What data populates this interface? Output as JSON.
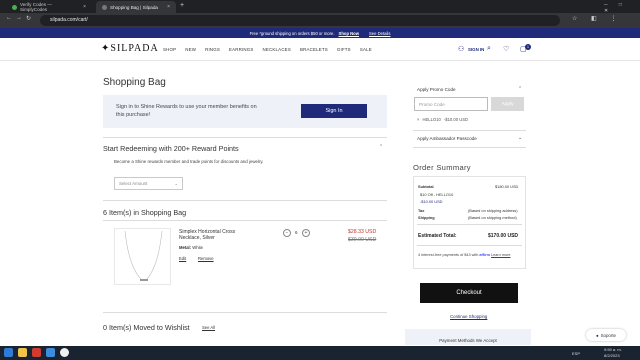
{
  "browser": {
    "tabs": [
      {
        "title": "Verify Codes — SimplyCodes"
      },
      {
        "title": "Shopping Bag | Silpada"
      }
    ],
    "url": "silpada.com/cart/"
  },
  "banner": {
    "text": "Free *ground shipping on orders $50 or more.",
    "shop_now": "Shop Now",
    "see_details": "See Details"
  },
  "header": {
    "logo": "SILPADA",
    "nav": [
      "SHOP",
      "NEW",
      "RINGS",
      "EARRINGS",
      "NECKLACES",
      "BRACELETS",
      "GIFTS",
      "SALE"
    ],
    "signin": "SIGN IN",
    "cart_count": "1"
  },
  "page": {
    "title": "Shopping Bag"
  },
  "rewards": {
    "text": "Sign in to Shine Rewards to use your member benefits on this purchase!",
    "button": "Sign In"
  },
  "redeem": {
    "title": "Start Redeeming with 200+ Reward Points",
    "subtitle": "Become a Shine rewards member and trade points for discounts and jewelry.",
    "select_placeholder": "Select Amount"
  },
  "bag": {
    "title": "6 Item(s) in Shopping Bag",
    "item": {
      "name": "Simplex Horizontal Cross Necklace, Silver",
      "metal_label": "Metal:",
      "metal_value": "White",
      "edit": "Edit",
      "remove": "Remove",
      "qty": "6",
      "sale_price": "$28.33 USD",
      "old_price": "$30.00 USD"
    }
  },
  "wishlist": {
    "title": "0 Item(s) Moved to Wishlist",
    "see_all": "See All"
  },
  "promo": {
    "label": "Apply Promo Code",
    "placeholder": "Promo Code",
    "apply": "Apply",
    "applied_code": "HELLO10",
    "applied_desc": "-$10.00 USD"
  },
  "ambassador": {
    "label": "Apply Ambassador Passcode"
  },
  "summary": {
    "title": "Order Summary",
    "subtotal_label": "Subtotal",
    "subtotal_value": "$180.00 USD",
    "discount_label": "$10 Off - HELLO10",
    "discount_value": "-$10.00 USD",
    "tax_label": "Tax",
    "tax_value": "(Based on shipping address)",
    "shipping_label": "Shipping",
    "shipping_value": "(Based on shipping method)",
    "est_label": "Estimated Total:",
    "est_value": "$170.00 USD",
    "affirm_text": "4 interest-free payments of $43 with",
    "affirm_brand": "affirm",
    "learn_more": "Learn more"
  },
  "checkout": {
    "button": "Checkout",
    "continue": "Continue Shopping",
    "payment_methods": "Payment Methods We Accept"
  },
  "support": {
    "label": "Soporte"
  },
  "taskbar": {
    "lang": "ESP",
    "time": "9:59 a. m.",
    "date": "8/2/2023"
  }
}
